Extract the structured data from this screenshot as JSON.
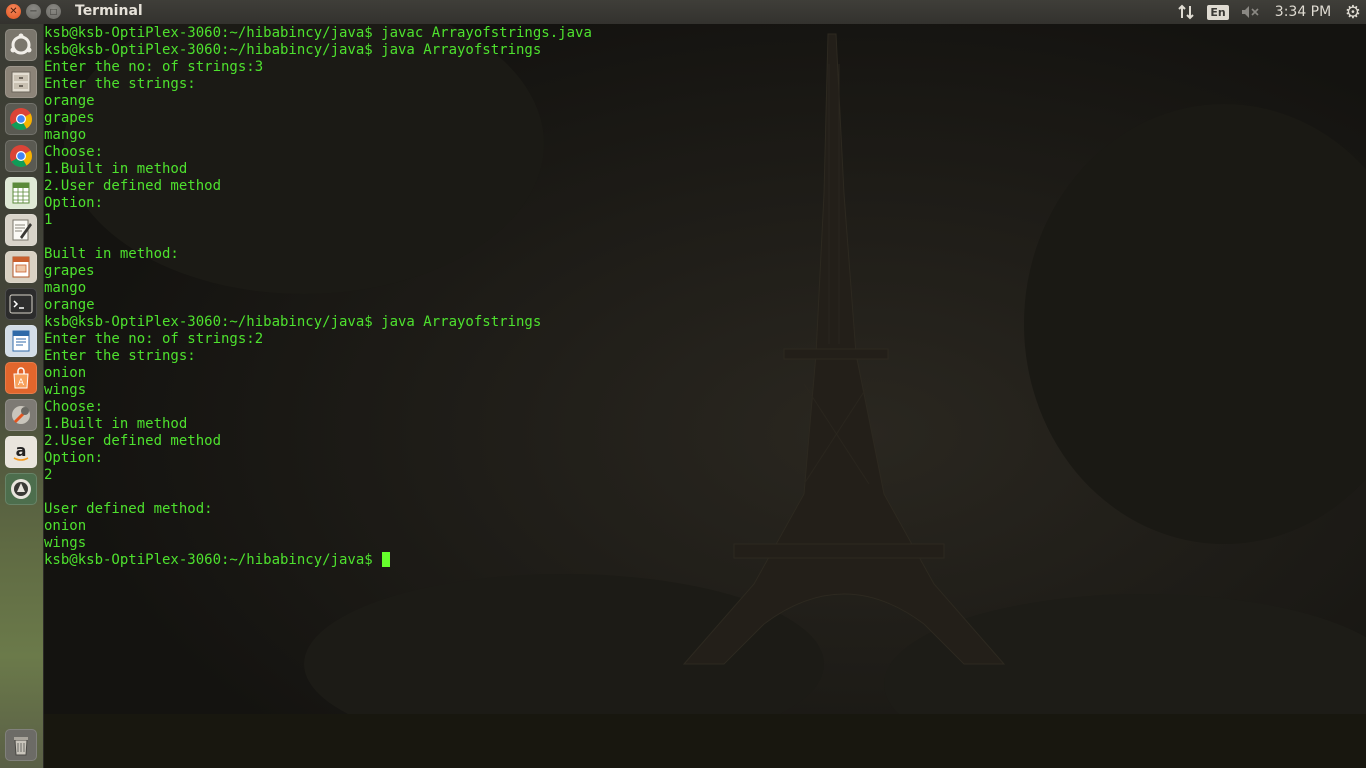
{
  "top_panel": {
    "window_title": "Terminal",
    "keyboard_layout": "En",
    "clock": "3:34 PM"
  },
  "launcher": {
    "items": [
      {
        "name": "dash",
        "icon": "ubuntu-logo-icon",
        "color": "#7a766c"
      },
      {
        "name": "files",
        "icon": "file-cabinet-icon",
        "color": "#8c8478"
      },
      {
        "name": "chrome",
        "icon": "chrome-icon",
        "color": "#5a5a52"
      },
      {
        "name": "chrome-2",
        "icon": "chrome-icon",
        "color": "#5a5a52"
      },
      {
        "name": "calc",
        "icon": "spreadsheet-icon",
        "color": "#dfe9d5"
      },
      {
        "name": "text-editor",
        "icon": "text-editor-icon",
        "color": "#d8d4c9"
      },
      {
        "name": "impress",
        "icon": "presentation-icon",
        "color": "#d9d2c3"
      },
      {
        "name": "terminal",
        "icon": "terminal-icon",
        "color": "#2c2c2c"
      },
      {
        "name": "writer",
        "icon": "document-icon",
        "color": "#d3dde7"
      },
      {
        "name": "software-center",
        "icon": "shopping-bag-icon",
        "color": "#e2662c"
      },
      {
        "name": "system-settings",
        "icon": "wrench-icon",
        "color": "#7d7a74"
      },
      {
        "name": "amazon",
        "icon": "amazon-icon",
        "color": "#e9e5dd"
      },
      {
        "name": "updater",
        "icon": "update-icon",
        "color": "#4d6e4d"
      },
      {
        "name": "trash",
        "icon": "trash-icon",
        "color": "#6c6b66"
      }
    ]
  },
  "terminal": {
    "lines": [
      "ksb@ksb-OptiPlex-3060:~/hibabincy/java$ javac Arrayofstrings.java",
      "ksb@ksb-OptiPlex-3060:~/hibabincy/java$ java Arrayofstrings",
      "Enter the no: of strings:3",
      "Enter the strings:",
      "orange",
      "grapes",
      "mango",
      "Choose:",
      "1.Built in method",
      "2.User defined method",
      "Option:",
      "1",
      "",
      "Built in method:",
      "grapes",
      "mango",
      "orange",
      "ksb@ksb-OptiPlex-3060:~/hibabincy/java$ java Arrayofstrings",
      "Enter the no: of strings:2",
      "Enter the strings:",
      "onion",
      "wings",
      "Choose:",
      "1.Built in method",
      "2.User defined method",
      "Option:",
      "2",
      "",
      "User defined method:",
      "onion",
      "wings"
    ],
    "prompt": "ksb@ksb-OptiPlex-3060:~/hibabincy/java$ ",
    "text_color": "#4ee12e",
    "cursor_color": "#66ff2c"
  }
}
